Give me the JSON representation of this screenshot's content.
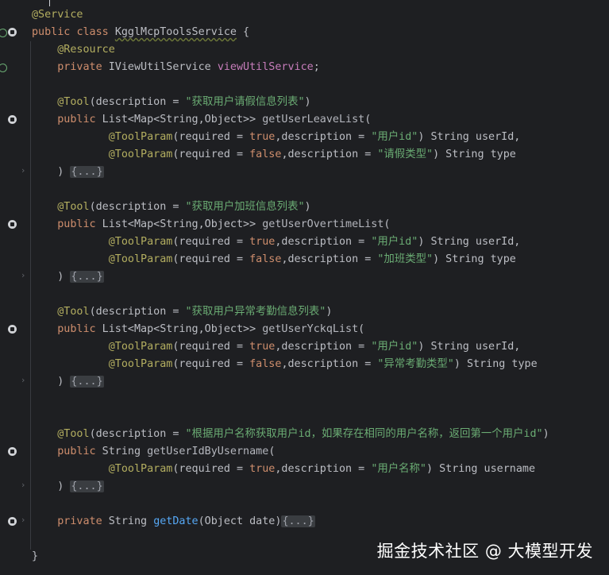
{
  "code": {
    "service_ann": "@Service",
    "kw_public": "public",
    "kw_class": "class",
    "class_name": "KgglMcpToolsService",
    "brace_open": " {",
    "resource_ann": "@Resource",
    "kw_private": "private",
    "iface_type": "IViewUtilService",
    "field_name": "viewUtilService",
    "semicolon": ";",
    "tool_ann": "@Tool",
    "toolparam_ann": "@ToolParam",
    "desc_open": "(description = ",
    "close_paren": ")",
    "list_type": " List<Map<String,Object>> ",
    "req_open": "(required = ",
    "kw_true": "true",
    "kw_false": "false",
    "desc_mid": ",description = ",
    "string_userid_tail": ") String userId,",
    "string_type_tail": ") String type",
    "string_username_tail": ") String username",
    "fold_close_prefix": ") ",
    "folded": "{...}",
    "open_paren": "(",
    "kw_string_type": " String ",
    "object_param": "(Object date)",
    "closing_brace": "}",
    "m1": {
      "desc": "\"获取用户请假信息列表\"",
      "name": "getUserLeaveList",
      "p1_desc": "\"用户id\"",
      "p2_desc": "\"请假类型\""
    },
    "m2": {
      "desc": "\"获取用户加班信息列表\"",
      "name": "getUserOvertimeList",
      "p1_desc": "\"用户id\"",
      "p2_desc": "\"加班类型\""
    },
    "m3": {
      "desc": "\"获取用户异常考勤信息列表\"",
      "name": "getUserYckqList",
      "p1_desc": "\"用户id\"",
      "p2_desc": "\"异常考勤类型\""
    },
    "m4": {
      "desc": "\"根据用户名称获取用户id，如果存在相同的用户名称，返回第一个用户id\"",
      "name": "getUserIdByUsername",
      "p1_desc": "\"用户名称\""
    },
    "m5": {
      "name": "getDate"
    }
  },
  "watermark": "掘金技术社区 @ 大模型开发",
  "colors": {
    "background": "#1e1f22",
    "keyword": "#cf8e6d",
    "annotation": "#b3ae60",
    "string": "#6aab73",
    "function": "#56a8f5",
    "field": "#c77dbb"
  },
  "icons": [
    "implementation-marker-icon",
    "chevron-right-icon",
    "bean-marker-icon"
  ]
}
